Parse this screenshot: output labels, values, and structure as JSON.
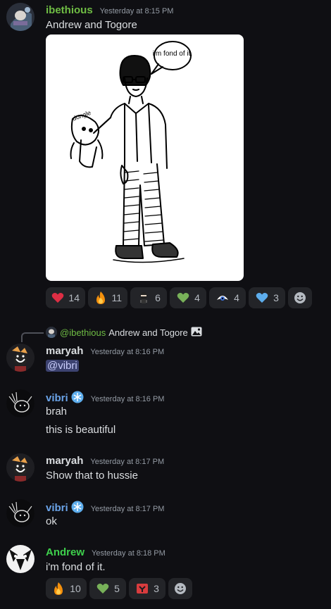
{
  "colors": {
    "ibethious": "#6fbd44",
    "maryah": "#dbdee1",
    "vibri": "#6aa3e8",
    "andrew": "#3ed04c",
    "timestamp": "#949ba4",
    "background": "#0f0f13",
    "reaction_bg": "#232428"
  },
  "messages": [
    {
      "author": "ibethious",
      "timestamp": "Yesterday at 8:15 PM",
      "text": "Andrew and Togore",
      "attachment": {
        "type": "image",
        "drawn_text": "i'm fond of it.",
        "toy_label": "dongle"
      },
      "reactions": [
        {
          "icon": "red-heart-icon",
          "count": "14"
        },
        {
          "icon": "fire-icon",
          "count": "11"
        },
        {
          "icon": "ninja-emoji-icon",
          "count": "6"
        },
        {
          "icon": "green-heart-icon",
          "count": "4"
        },
        {
          "icon": "sprite-emoji-icon",
          "count": "4"
        },
        {
          "icon": "blue-heart-icon",
          "count": "3"
        }
      ]
    },
    {
      "author": "maryah",
      "timestamp": "Yesterday at 8:16 PM",
      "reply": {
        "author": "@ibethious",
        "text": "Andrew and Togore"
      },
      "mention": "@vibri"
    },
    {
      "author": "vibri",
      "timestamp": "Yesterday at 8:16 PM",
      "lines": [
        "brah",
        "this is beautiful"
      ]
    },
    {
      "author": "maryah",
      "timestamp": "Yesterday at 8:17 PM",
      "text": "Show that to hussie"
    },
    {
      "author": "vibri",
      "timestamp": "Yesterday at 8:17 PM",
      "text": "ok"
    },
    {
      "author": "Andrew",
      "timestamp": "Yesterday at 8:18 PM",
      "text": "i'm fond of it.",
      "reactions": [
        {
          "icon": "fire-icon",
          "count": "10"
        },
        {
          "icon": "green-heart-icon",
          "count": "5"
        },
        {
          "icon": "red-symbol-emoji-icon",
          "count": "3"
        }
      ]
    }
  ]
}
